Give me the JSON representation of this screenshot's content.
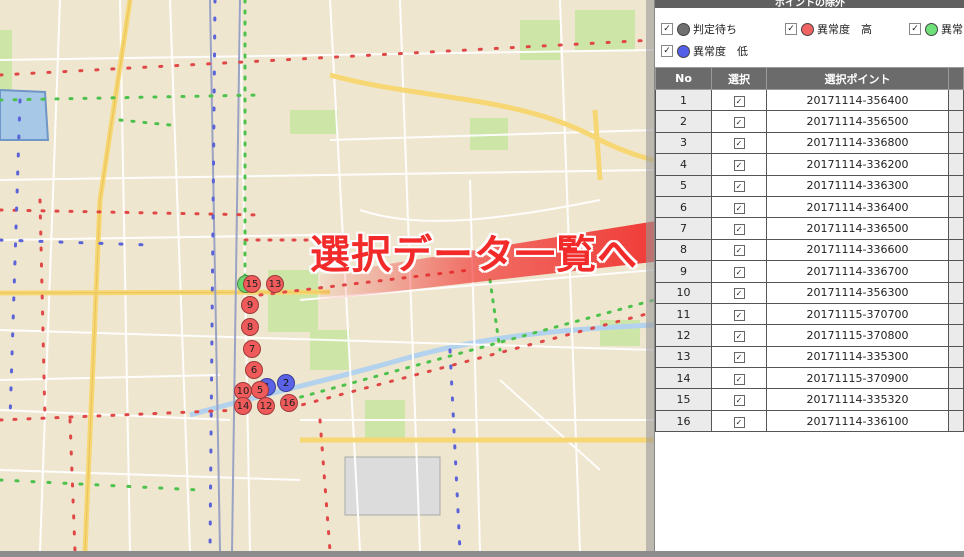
{
  "panel": {
    "title": "ポイントの除外",
    "legend": [
      {
        "label": "判定待ち",
        "color": "#707070",
        "checked": true
      },
      {
        "label": "異常度　高",
        "color": "#f06464",
        "checked": true
      },
      {
        "label": "異常",
        "color": "#6fe07a",
        "checked": true
      },
      {
        "label": "異常度　低",
        "color": "#5560e8",
        "checked": true
      }
    ],
    "table": {
      "headers": [
        "No",
        "選択",
        "選択ポイント"
      ],
      "rows": [
        {
          "no": "1",
          "point": "20171114-356400"
        },
        {
          "no": "2",
          "point": "20171114-356500"
        },
        {
          "no": "3",
          "point": "20171114-336800"
        },
        {
          "no": "4",
          "point": "20171114-336200"
        },
        {
          "no": "5",
          "point": "20171114-336300"
        },
        {
          "no": "6",
          "point": "20171114-336400"
        },
        {
          "no": "7",
          "point": "20171114-336500"
        },
        {
          "no": "8",
          "point": "20171114-336600"
        },
        {
          "no": "9",
          "point": "20171114-336700"
        },
        {
          "no": "10",
          "point": "20171114-356300"
        },
        {
          "no": "11",
          "point": "20171115-370700"
        },
        {
          "no": "12",
          "point": "20171115-370800"
        },
        {
          "no": "13",
          "point": "20171114-335300"
        },
        {
          "no": "14",
          "point": "20171115-370900"
        },
        {
          "no": "15",
          "point": "20171114-335320"
        },
        {
          "no": "16",
          "point": "20171114-336100"
        }
      ]
    }
  },
  "callout": "選択データ一覧へ",
  "markers": [
    {
      "label": "15",
      "kind": "red"
    },
    {
      "label": "13",
      "kind": "red"
    },
    {
      "label": "9",
      "kind": "red"
    },
    {
      "label": "8",
      "kind": "red"
    },
    {
      "label": "7",
      "kind": "red"
    },
    {
      "label": "6",
      "kind": "red"
    },
    {
      "label": "1",
      "kind": "blue"
    },
    {
      "label": "2",
      "kind": "blue"
    },
    {
      "label": "10",
      "kind": "red"
    },
    {
      "label": "5",
      "kind": "red"
    },
    {
      "label": "14",
      "kind": "red"
    },
    {
      "label": "12",
      "kind": "red"
    },
    {
      "label": "16",
      "kind": "red"
    }
  ],
  "colors": {
    "anomaly_high": "#f06464",
    "anomaly_low": "#5560e8",
    "pending": "#707070",
    "anomaly_mid": "#6fe07a",
    "arrow": "#f01e1e"
  }
}
